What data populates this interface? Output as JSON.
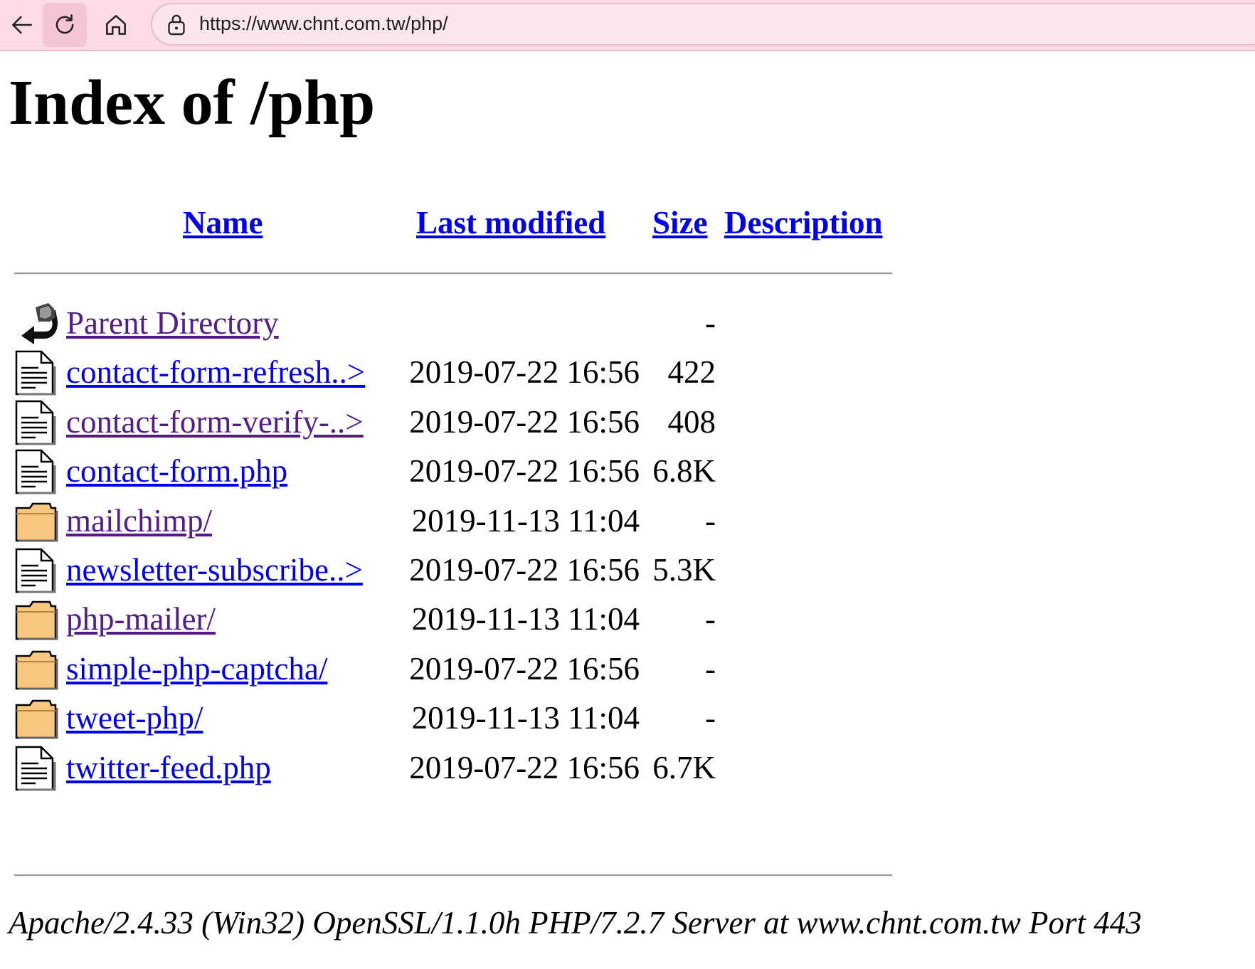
{
  "browser": {
    "url": "https://www.chnt.com.tw/php/"
  },
  "page": {
    "title": "Index of /php",
    "columns": {
      "name": "Name",
      "last_modified": "Last modified",
      "size": "Size",
      "description": "Description"
    },
    "entries": [
      {
        "icon": "back-icon",
        "name": "Parent Directory",
        "date": "",
        "size": "-",
        "visited": true
      },
      {
        "icon": "file-icon",
        "name": "contact-form-refresh..>",
        "date": "2019-07-22 16:56",
        "size": "422",
        "visited": false
      },
      {
        "icon": "file-icon",
        "name": "contact-form-verify-..>",
        "date": "2019-07-22 16:56",
        "size": "408",
        "visited": true
      },
      {
        "icon": "file-icon",
        "name": "contact-form.php",
        "date": "2019-07-22 16:56",
        "size": "6.8K",
        "visited": false
      },
      {
        "icon": "folder-icon",
        "name": "mailchimp/",
        "date": "2019-11-13 11:04",
        "size": "-",
        "visited": true
      },
      {
        "icon": "file-icon",
        "name": "newsletter-subscribe..>",
        "date": "2019-07-22 16:56",
        "size": "5.3K",
        "visited": false
      },
      {
        "icon": "folder-icon",
        "name": "php-mailer/",
        "date": "2019-11-13 11:04",
        "size": "-",
        "visited": true
      },
      {
        "icon": "folder-icon",
        "name": "simple-php-captcha/",
        "date": "2019-07-22 16:56",
        "size": "-",
        "visited": false
      },
      {
        "icon": "folder-icon",
        "name": "tweet-php/",
        "date": "2019-11-13 11:04",
        "size": "-",
        "visited": false
      },
      {
        "icon": "file-icon",
        "name": "twitter-feed.php",
        "date": "2019-07-22 16:56",
        "size": "6.7K",
        "visited": false
      }
    ],
    "footer": "Apache/2.4.33 (Win32) OpenSSL/1.1.0h PHP/7.2.7 Server at www.chnt.com.tw Port 443"
  },
  "colors": {
    "toolbar_bg": "#fddbe6",
    "link_unvisited": "#0000ee",
    "link_visited": "#551a8b",
    "folder_fill": "#f7c77f"
  }
}
